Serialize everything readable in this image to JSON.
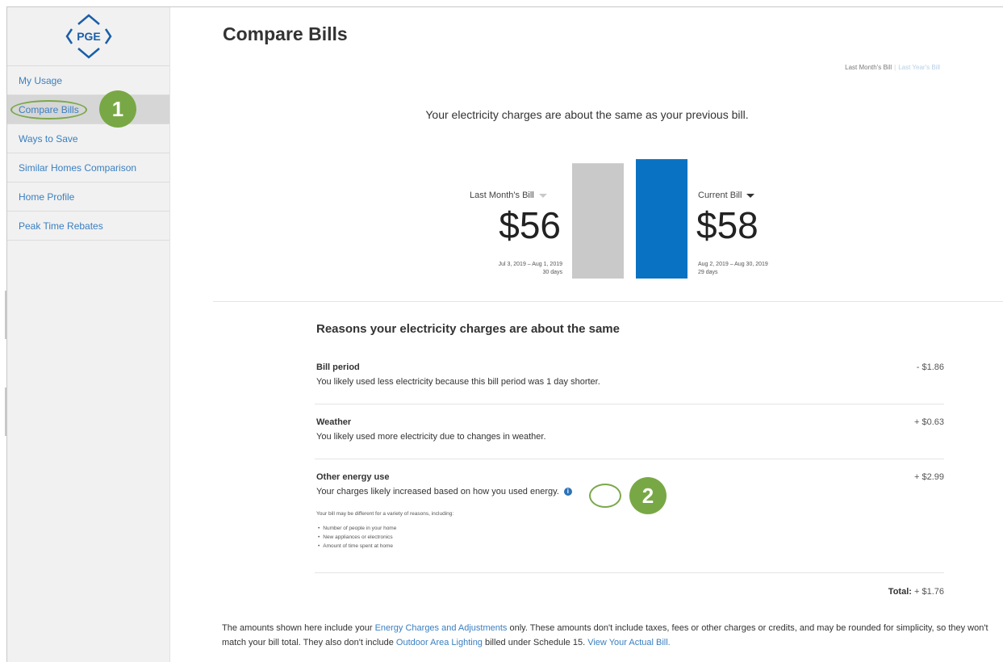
{
  "logo": {
    "text": "PGE",
    "color": "#1b5ea8"
  },
  "sidebar": {
    "items": [
      {
        "label": "My Usage"
      },
      {
        "label": "Compare Bills",
        "active": true
      },
      {
        "label": "Ways to Save"
      },
      {
        "label": "Similar Homes Comparison"
      },
      {
        "label": "Home Profile"
      },
      {
        "label": "Peak Time Rebates"
      }
    ]
  },
  "annotations": {
    "badge1": "1",
    "badge2": "2",
    "badge_color": "#78a845"
  },
  "page": {
    "title": "Compare Bills",
    "toggle": {
      "active": "Last Month's Bill",
      "inactive": "Last Year's Bill"
    },
    "summary": "Your electricity charges are about the same as your previous bill."
  },
  "bills": {
    "previous": {
      "label": "Last Month's Bill",
      "amount": "$56",
      "value": 56,
      "dates": "Jul 3, 2019 – Aug 1, 2019",
      "days": "30 days",
      "color": "#c9c9c9"
    },
    "current": {
      "label": "Current Bill",
      "amount": "$58",
      "value": 58,
      "dates": "Aug 2, 2019 – Aug 30, 2019",
      "days": "29 days",
      "color": "#0a72c2"
    }
  },
  "reasons": {
    "title": "Reasons your electricity charges are about the same",
    "items": [
      {
        "title": "Bill period",
        "desc": "You likely used less electricity because this bill period was 1 day shorter.",
        "amount": "- $1.86"
      },
      {
        "title": "Weather",
        "desc": "You likely used more electricity due to changes in weather.",
        "amount": "+ $0.63"
      },
      {
        "title": "Other energy use",
        "desc": "Your charges likely increased based on how you used energy.",
        "amount": "+ $2.99",
        "detail_intro": "Your bill may be different for a variety of reasons, including:",
        "detail_list": [
          "Number of people in your home",
          "New appliances or electronics",
          "Amount of time spent at home"
        ]
      }
    ],
    "total_label": "Total:",
    "total_value": "+ $1.76"
  },
  "footer": {
    "t1": "The amounts shown here include your ",
    "link1": "Energy Charges and Adjustments",
    "t2": " only. These amounts don't include taxes, fees or other charges or credits, and may be rounded for simplicity, so they won't match your bill total. They also don't include ",
    "link2": "Outdoor Area Lighting",
    "t3": " billed under Schedule 15. ",
    "link3": "View Your Actual Bill."
  }
}
